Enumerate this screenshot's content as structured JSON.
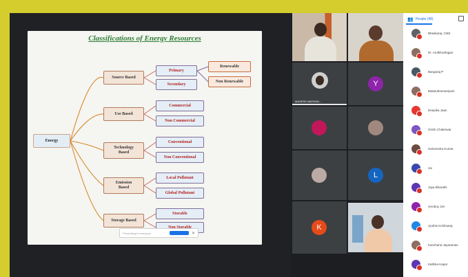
{
  "slide": {
    "title": "Classifications of Energy Resources",
    "root": "Energy",
    "branches": [
      {
        "label": "Source Based",
        "children": [
          "Primary",
          "Secondary"
        ],
        "leaves": [
          "Renewable",
          "Non Renewable"
        ]
      },
      {
        "label": "Use Based",
        "children": [
          "Commercial",
          "Non Commercial"
        ]
      },
      {
        "label": "Technology Based",
        "children": [
          "Conventional",
          "Non Conventional"
        ]
      },
      {
        "label": "Emission Based",
        "children": [
          "Local Pollutant",
          "Global Pollutant"
        ]
      },
      {
        "label": "Storage Based",
        "children": [
          "Storable",
          "Non Storable"
        ]
      }
    ]
  },
  "notification": {
    "text": "Presenting to everyone",
    "button": ""
  },
  "participants": {
    "tiles": [
      {
        "kind": "video",
        "label": ""
      },
      {
        "kind": "video",
        "label": ""
      },
      {
        "kind": "avatar",
        "label": "MAHESH MATHAN...",
        "initial": "",
        "color": "#5f6368"
      },
      {
        "kind": "avatar",
        "label": "",
        "initial": "Y",
        "color": "#8e24aa"
      },
      {
        "kind": "avatar",
        "label": "",
        "initial": "",
        "color": "#c2185b"
      },
      {
        "kind": "avatar",
        "label": "",
        "initial": "",
        "color": "#6d4c41"
      },
      {
        "kind": "avatar",
        "label": "",
        "initial": "",
        "color": "#795548"
      },
      {
        "kind": "avatar",
        "label": "",
        "initial": "L",
        "color": "#1565c0"
      },
      {
        "kind": "avatar",
        "label": "",
        "initial": "K",
        "color": "#e64a19"
      },
      {
        "kind": "video",
        "label": ""
      }
    ]
  },
  "people_panel": {
    "tab_label": "People (48)",
    "people": [
      {
        "name": "Bhaskaraj, CMS",
        "color": "#5f6368"
      },
      {
        "name": "Dr. Arulkhovilagan",
        "color": "#8d6e63"
      },
      {
        "name": "Bangaraj P",
        "color": "#455a64"
      },
      {
        "name": "Balasubramaniyam",
        "color": "#8d6e63"
      },
      {
        "name": "Deepika Jaan",
        "color": "#e53935"
      },
      {
        "name": "Girish Chakravar",
        "color": "#7e57c2"
      },
      {
        "name": "Harivendra Kumar",
        "color": "#6d4c41"
      },
      {
        "name": "Jai",
        "color": "#3949ab"
      },
      {
        "name": "Jaya Bharathi",
        "color": "#5e35b1"
      },
      {
        "name": "Jeroboy Jen",
        "color": "#8e24aa"
      },
      {
        "name": "Jyothis Krishnaraj",
        "color": "#1e88e5"
      },
      {
        "name": "Kanchana Jayaraman",
        "color": "#8d6e63"
      },
      {
        "name": "Kathika Kapar",
        "color": "#5e35b1"
      }
    ]
  }
}
